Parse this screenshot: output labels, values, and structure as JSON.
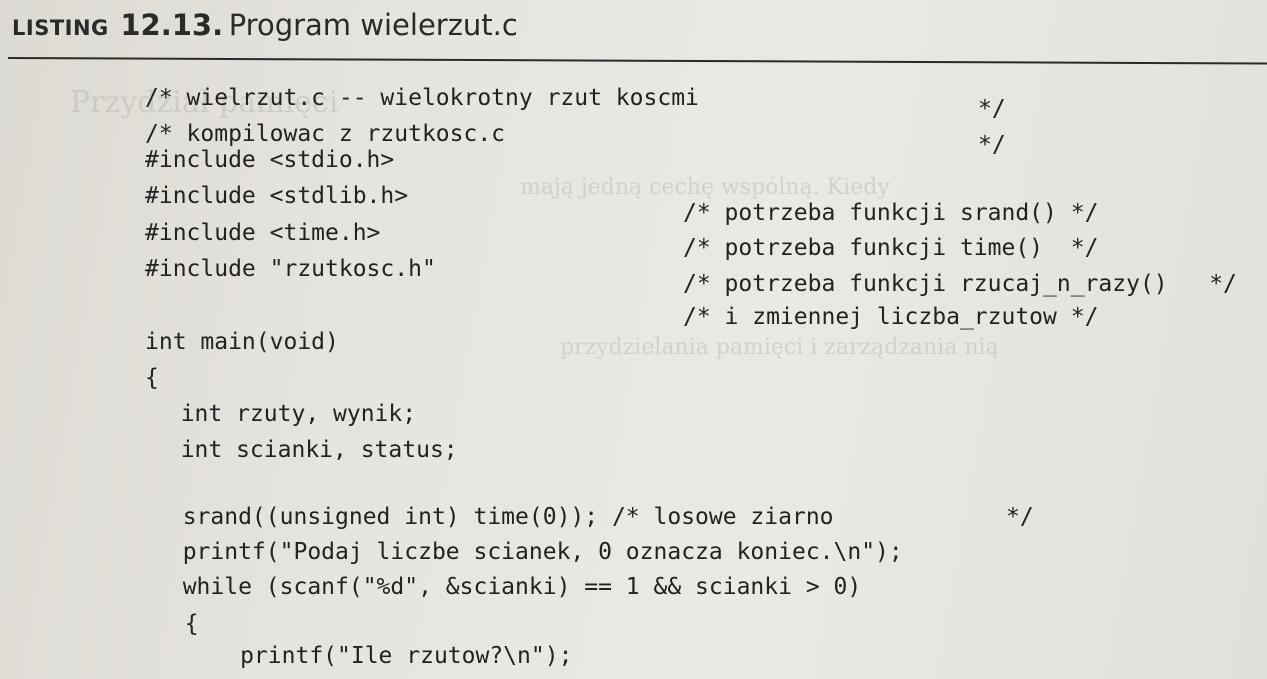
{
  "listing": {
    "label": "Listing",
    "number": "12.13.",
    "title": "Program wielerzut.c"
  },
  "code_lines": [
    "/* wielrzut.c -- wielokrotny rzut koscmi",
    "/* kompilowac z rzutkosc.c",
    "#include <stdio.h>",
    "#include <stdlib.h>",
    "#include <time.h>",
    "#include \"rzutkosc.h\"",
    "int main(void)",
    "{",
    "  int rzuty, wynik;",
    "  int scianki, status;",
    "  srand((unsigned int) time(0)); /* losowe ziarno",
    "  printf(\"Podaj liczbe scianek, 0 oznacza koniec.\\n\");",
    "  while (scanf(\"%d\", &scianki) == 1 && scianki > 0)",
    "  {",
    "      printf(\"Ile rzutow?\\n\");"
  ],
  "comments": [
    "*/",
    "*/",
    "/* potrzeba funkcji srand() */",
    "/* potrzeba funkcji time()  */",
    "/* potrzeba funkcji rzucaj_n_razy()   */",
    "/* i zmiennej liczba_rzutow */",
    "*/"
  ]
}
